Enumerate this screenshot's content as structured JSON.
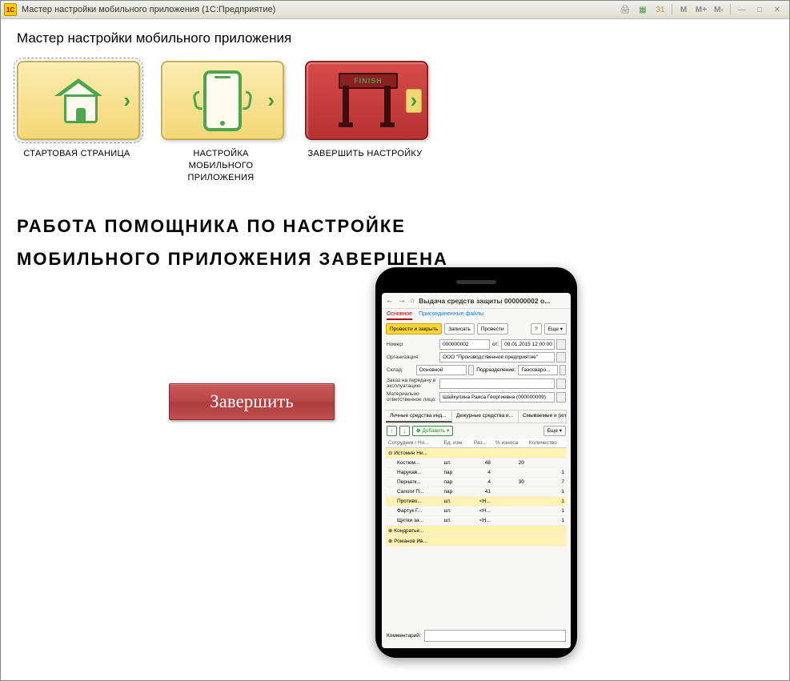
{
  "titlebar": {
    "logo_text": "1C",
    "title": "Мастер настройки мобильного приложения  (1С:Предприятие)",
    "mbtn1": "M",
    "mbtn2": "M+",
    "mbtn3": "M-",
    "min": "—",
    "max": "□",
    "close": "✕"
  },
  "page_heading": "Мастер настройки мобильного приложения",
  "steps": [
    {
      "label": "СТАРТОВАЯ СТРАНИЦА"
    },
    {
      "label": "НАСТРОЙКА МОБИЛЬНОГО ПРИЛОЖЕНИЯ"
    },
    {
      "label": "ЗАВЕРШИТЬ НАСТРОЙКУ",
      "banner": "FINISH"
    }
  ],
  "headline": "РАБОТА ПОМОЩНИКА ПО НАСТРОЙКЕ МОБИЛЬНОГО ПРИЛОЖЕНИЯ ЗАВЕРШЕНА",
  "finish_button": "Завершить",
  "phone": {
    "doc_title": "Выдача средств защиты 000000002 о...",
    "tabs": {
      "main": "Основное",
      "files": "Присоединенные файлы"
    },
    "toolbar": {
      "post_close": "Провести и закрыть",
      "save": "Записать",
      "post": "Провести",
      "q": "?",
      "more": "Еще ▾"
    },
    "fields": {
      "number_lbl": "Номер:",
      "number_val": "000000002",
      "date_lbl": "от:",
      "date_val": "09.01.2015 12:00:00",
      "org_lbl": "Организация:",
      "org_val": "ООО \"Производственное предприятие\"",
      "sklad_lbl": "Склад:",
      "sklad_val": "Основной",
      "podrazd_lbl": "Подразделение:",
      "podrazd_val": "Газосваро...",
      "order_lbl": "Заказ на передачу в эксплуатацию:",
      "order_val": "",
      "resp_lbl": "Материально ответственное лицо:",
      "resp_val": "Шайхулина Раиса Георгиевна (000000009)"
    },
    "subtabs": {
      "a": "Личные средства инд...",
      "b": "Дежурные средства и...",
      "c": "Смываемые и (или) о..."
    },
    "list_tb": {
      "add": "Добавить ▾",
      "more": "Еще ▾"
    },
    "columns": [
      "Сотрудник / Но...",
      "Ед. изм.",
      "Раз...",
      "% износа",
      "Количество"
    ],
    "groups": [
      {
        "title": "⊖ Истомин Ни...",
        "rows": [
          [
            "Костюм...",
            "шт.",
            "48",
            "20",
            ""
          ],
          [
            "Нарукав...",
            "пар",
            "4",
            "",
            "1"
          ],
          [
            "Перчатк...",
            "пар",
            "4",
            "30",
            "7"
          ],
          [
            "Сапоги П...",
            "пар",
            "41",
            "",
            "1"
          ],
          [
            "Противо...",
            "шт.",
            "<Н...",
            "",
            "1"
          ],
          [
            "Фартук Г...",
            "шт.",
            "<Н...",
            "",
            "1"
          ],
          [
            "Щитки за...",
            "шт.",
            "<Н...",
            "",
            "1"
          ]
        ]
      },
      {
        "title": "⊕ Кондратье...",
        "rows": []
      },
      {
        "title": "⊕ Романов Ив...",
        "rows": []
      }
    ],
    "comment_lbl": "Комментарий:"
  }
}
